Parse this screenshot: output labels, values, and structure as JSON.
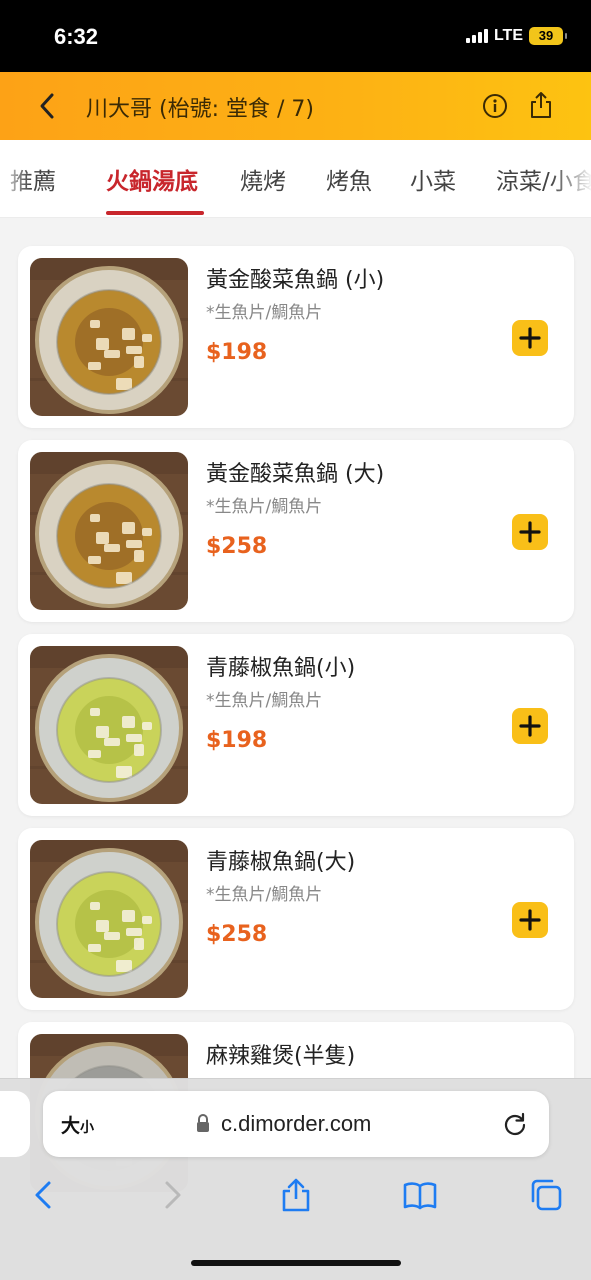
{
  "status": {
    "time": "6:32",
    "network": "LTE",
    "battery": "39"
  },
  "header": {
    "title": "川大哥 (枱號: 堂食 / 7)"
  },
  "tabs": [
    {
      "label": "推薦"
    },
    {
      "label": "火鍋湯底"
    },
    {
      "label": "燒烤"
    },
    {
      "label": "烤魚"
    },
    {
      "label": "小菜"
    },
    {
      "label": "涼菜/小食"
    }
  ],
  "items": [
    {
      "name": "黃金酸菜魚鍋 (小)",
      "desc": "*生魚片/鯛魚片",
      "price": "$198",
      "soup": "golden"
    },
    {
      "name": "黃金酸菜魚鍋 (大)",
      "desc": "*生魚片/鯛魚片",
      "price": "$258",
      "soup": "golden"
    },
    {
      "name": "青藤椒魚鍋(小)",
      "desc": "*生魚片/鯛魚片",
      "price": "$198",
      "soup": "green"
    },
    {
      "name": "青藤椒魚鍋(大)",
      "desc": "*生魚片/鯛魚片",
      "price": "$258",
      "soup": "green"
    },
    {
      "name": "麻辣雞煲(半隻)",
      "desc": "",
      "price": "",
      "soup": "chicken"
    }
  ],
  "browser": {
    "text_size_big": "大",
    "text_size_small": "小",
    "url": "c.dimorder.com"
  },
  "colors": {
    "accent": "#c8262c",
    "price": "#e8621e",
    "header": "#fdb214",
    "add_button": "#f9bf18"
  }
}
